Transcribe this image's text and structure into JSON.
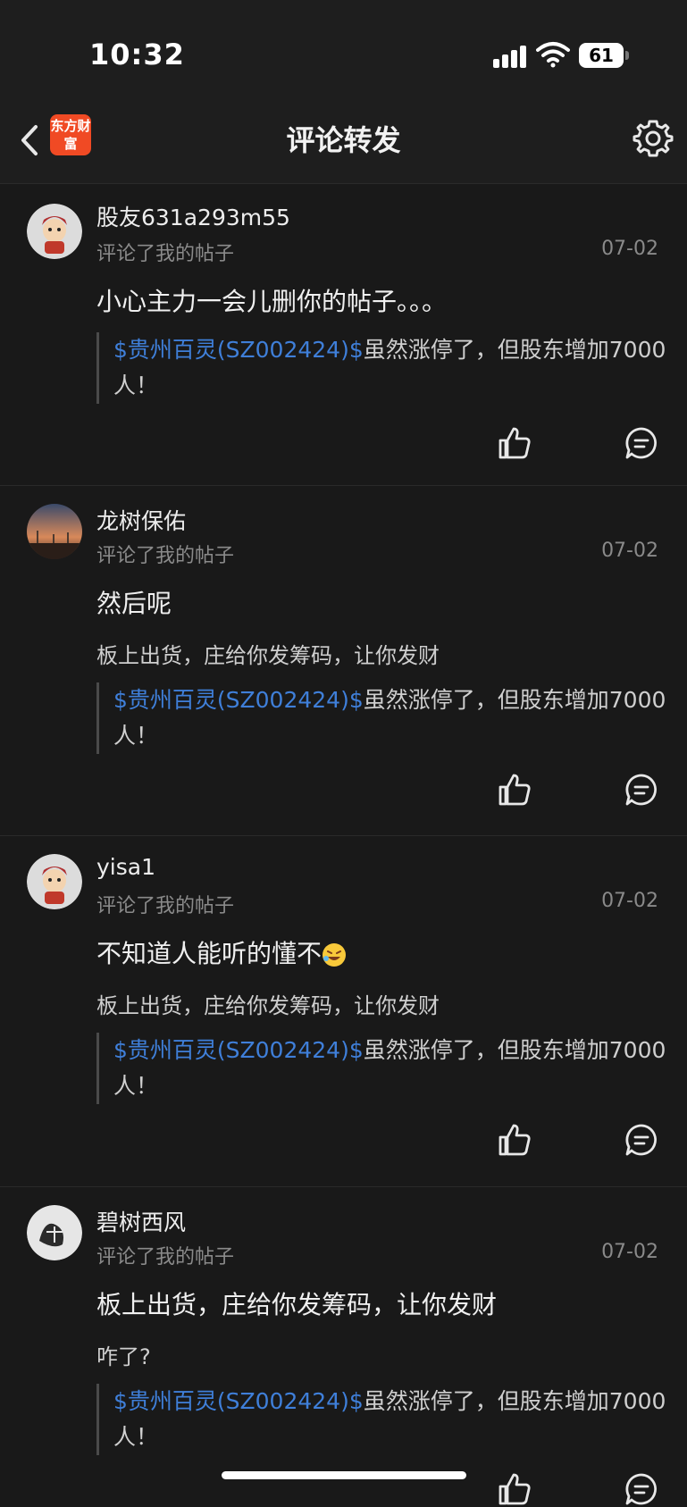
{
  "status_bar": {
    "time": "10:32",
    "battery": "61"
  },
  "header": {
    "title": "评论转发",
    "logo_text": "东方财富"
  },
  "comments": [
    {
      "username": "股友631a293m55",
      "action": "评论了我的帖子",
      "date": "07-02",
      "content": "小心主力一会儿删你的帖子。。。",
      "reply_text": "",
      "quote_stock": "$贵州百灵(SZ002424)$",
      "quote_text": "虽然涨停了，但股东增加7000人！"
    },
    {
      "username": "龙树保佑",
      "action": "评论了我的帖子",
      "date": "07-02",
      "content": "然后呢",
      "reply_text": "板上出货，庄给你发筹码，让你发财",
      "quote_stock": "$贵州百灵(SZ002424)$",
      "quote_text": "虽然涨停了，但股东增加7000人！"
    },
    {
      "username": "yisa1",
      "action": "评论了我的帖子",
      "date": "07-02",
      "content": "不知道人能听的懂不",
      "reply_text": "板上出货，庄给你发筹码，让你发财",
      "quote_stock": "$贵州百灵(SZ002424)$",
      "quote_text": "虽然涨停了，但股东增加7000人！"
    },
    {
      "username": "碧树西风",
      "action": "评论了我的帖子",
      "date": "07-02",
      "content": "板上出货，庄给你发筹码，让你发财",
      "reply_text": "咋了?",
      "quote_stock": "$贵州百灵(SZ002424)$",
      "quote_text": "虽然涨停了，但股东增加7000人！"
    }
  ],
  "colors": {
    "background": "#191919",
    "stock_link": "#3f7fd9",
    "logo": "#f04a24"
  }
}
